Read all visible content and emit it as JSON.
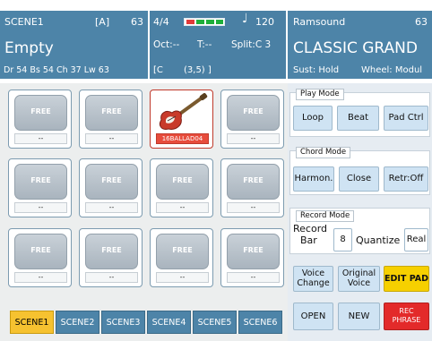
{
  "header": {
    "left": {
      "scene": "SCENE1",
      "slot": "[A]",
      "number": "63",
      "status": "Empty",
      "levels": "Dr 54  Bs 54  Ch 37  Lw 63"
    },
    "mid": {
      "time_signature": "4/4",
      "tempo": "120",
      "octave": "Oct:--",
      "transpose": "T:--",
      "split": "Split:C 3",
      "chord_open": "[C",
      "chord_pos": "(3,5) ]"
    },
    "right": {
      "bank": "Ramsound",
      "number": "63",
      "sound_name": "CLASSIC GRAND",
      "sustain": "Sust: Hold",
      "wheel": "Wheel: Modul"
    }
  },
  "pads": [
    {
      "label": "FREE",
      "caption": "--"
    },
    {
      "label": "FREE",
      "caption": "--"
    },
    {
      "label": "",
      "caption": "16BALLAD04",
      "active": true
    },
    {
      "label": "FREE",
      "caption": "--"
    },
    {
      "label": "FREE",
      "caption": "--"
    },
    {
      "label": "FREE",
      "caption": "--"
    },
    {
      "label": "FREE",
      "caption": "--"
    },
    {
      "label": "FREE",
      "caption": "--"
    },
    {
      "label": "FREE",
      "caption": "--"
    },
    {
      "label": "FREE",
      "caption": "--"
    },
    {
      "label": "FREE",
      "caption": "--"
    },
    {
      "label": "FREE",
      "caption": "--"
    }
  ],
  "scenes": [
    "SCENE1",
    "SCENE2",
    "SCENE3",
    "SCENE4",
    "SCENE5",
    "SCENE6"
  ],
  "play_mode": {
    "title": "Play Mode",
    "loop": "Loop",
    "beat": "Beat",
    "pad_ctrl": "Pad Ctrl"
  },
  "chord_mode": {
    "title": "Chord Mode",
    "harmon": "Harmon.",
    "close": "Close",
    "retr": "Retr:Off"
  },
  "record_mode": {
    "title": "Record Mode",
    "record_bar_1": "Record",
    "record_bar_2": "Bar",
    "bar_value": "8",
    "quantize": "Quantize",
    "quantize_value": "Real"
  },
  "actions": {
    "voice_change_1": "Voice",
    "voice_change_2": "Change",
    "original_voice_1": "Original",
    "original_voice_2": "Voice",
    "edit_pad": "EDIT PAD",
    "open": "OPEN",
    "new": "NEW",
    "rec_phrase_1": "REC",
    "rec_phrase_2": "PHRASE"
  },
  "colors": {
    "header_blue": "#4d84a8",
    "selected_tab": "#f6c230",
    "edit_pad": "#f6d000",
    "rec_phrase": "#e32a2a",
    "active_pad": "#e74c3c"
  },
  "icons": {
    "note": "music-note-icon",
    "tempo_bar": "beat-indicator-icon",
    "pad_instrument": "electric-guitar-icon"
  }
}
